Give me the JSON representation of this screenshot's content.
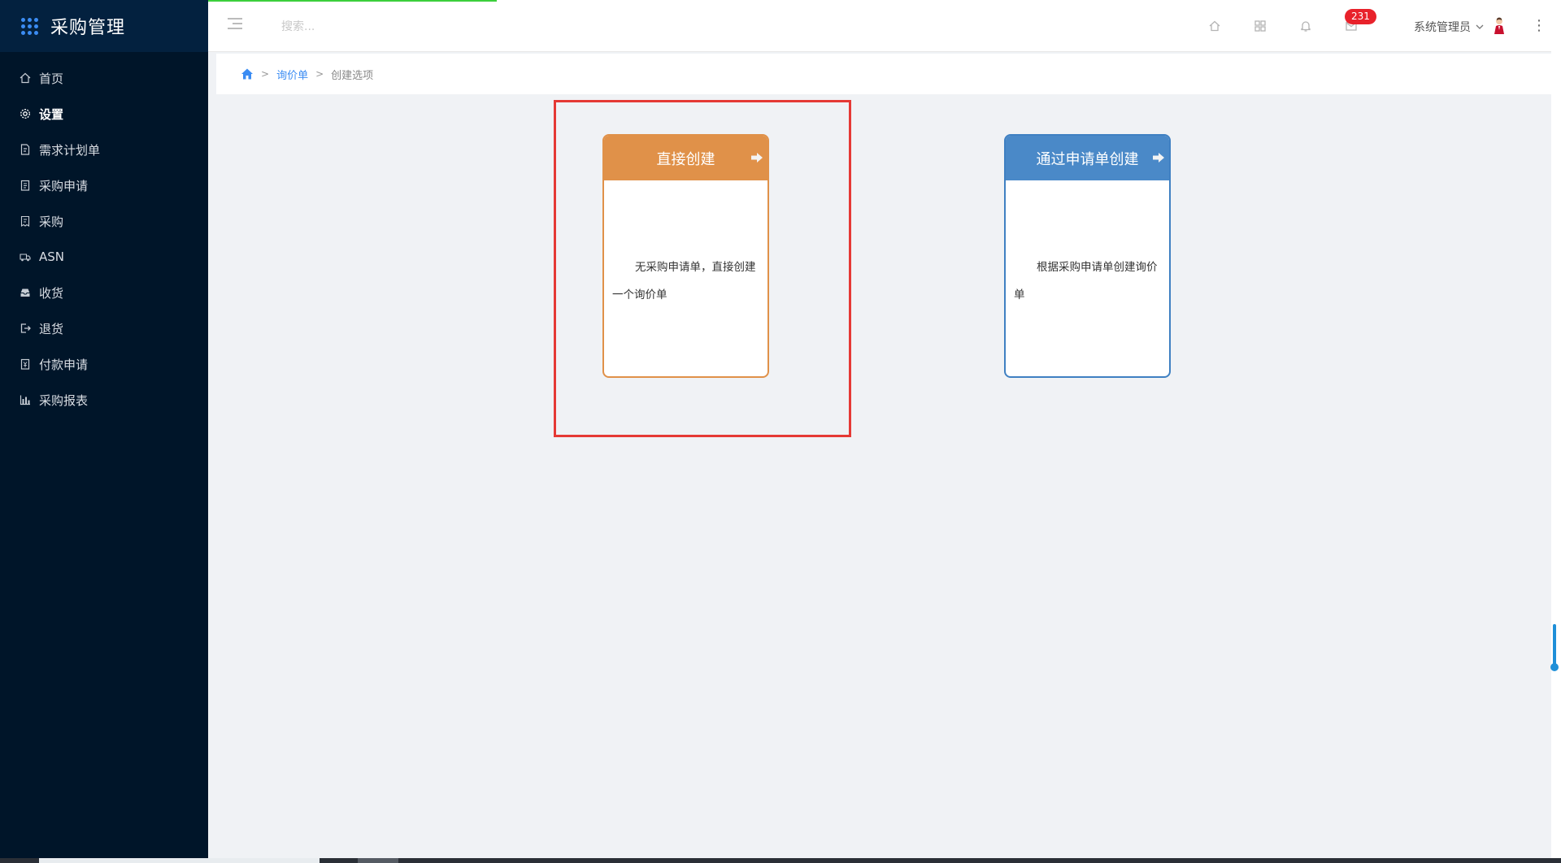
{
  "app": {
    "title": "采购管理"
  },
  "sidebar": {
    "items": [
      {
        "label": "首页",
        "icon": "home-icon",
        "active": false
      },
      {
        "label": "设置",
        "icon": "gear-icon",
        "active": true
      },
      {
        "label": "需求计划单",
        "icon": "document-icon",
        "active": false
      },
      {
        "label": "采购申请",
        "icon": "clipboard-icon",
        "active": false
      },
      {
        "label": "采购",
        "icon": "receipt-icon",
        "active": false
      },
      {
        "label": "ASN",
        "icon": "truck-icon",
        "active": false
      },
      {
        "label": "收货",
        "icon": "inbox-icon",
        "active": false
      },
      {
        "label": "退货",
        "icon": "return-icon",
        "active": false
      },
      {
        "label": "付款申请",
        "icon": "payment-icon",
        "active": false
      },
      {
        "label": "采购报表",
        "icon": "bar-chart-icon",
        "active": false
      }
    ]
  },
  "header": {
    "search_placeholder": "搜索...",
    "message_badge": "231",
    "user_name": "系统管理员"
  },
  "breadcrumb": {
    "items": [
      "询价单",
      "创建选项"
    ],
    "separator": ">"
  },
  "cards": [
    {
      "title": "直接创建",
      "description": "无采购申请单，直接创建一个询价单",
      "color": "#e09149"
    },
    {
      "title": "通过申请单创建",
      "description": "根据采购申请单创建询价单",
      "color": "#4a89c8"
    }
  ],
  "colors": {
    "sidebar_bg": "#001529",
    "accent": "#3b8cf3",
    "highlight": "#e53935",
    "badge": "#e8222b"
  }
}
